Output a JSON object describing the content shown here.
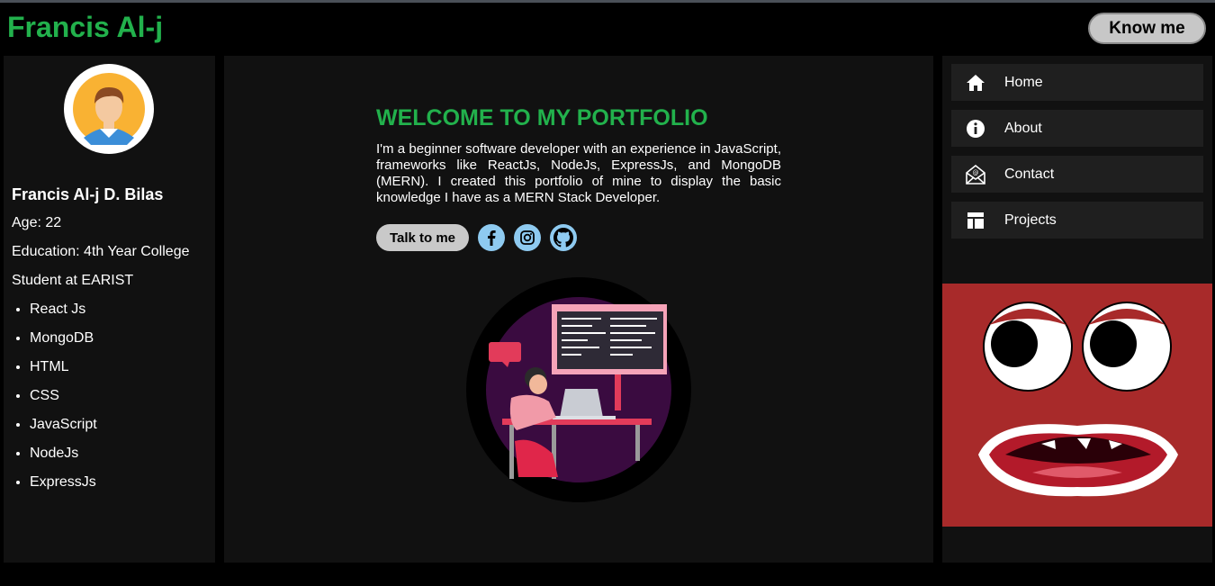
{
  "header": {
    "brand": "Francis Al-j",
    "know_me_label": "Know me"
  },
  "profile": {
    "name": "Francis Al-j D. Bilas",
    "age": "Age: 22",
    "education_line1": "Education: 4th Year College",
    "education_line2": "Student at EARIST",
    "skills": [
      "React Js",
      "MongoDB",
      "HTML",
      "CSS",
      "JavaScript",
      "NodeJs",
      "ExpressJs"
    ]
  },
  "main": {
    "heading": "WELCOME TO MY PORTFOLIO",
    "intro": "I'm a beginner software developer with an experience in JavaScript, frameworks like ReactJs, NodeJs, ExpressJs, and MongoDB (MERN). I created this portfolio of mine to display the basic knowledge I have as a MERN Stack Developer.",
    "talk_label": "Talk to me",
    "socials": [
      "facebook-icon",
      "instagram-icon",
      "github-icon"
    ]
  },
  "nav": {
    "items": [
      {
        "label": "Home",
        "icon": "home-icon"
      },
      {
        "label": "About",
        "icon": "info-icon"
      },
      {
        "label": "Contact",
        "icon": "contact-mail-icon"
      },
      {
        "label": "Projects",
        "icon": "layout-icon"
      }
    ]
  },
  "colors": {
    "accent": "#22b14c",
    "background": "#000000",
    "panel": "#111111",
    "nav_item": "#1f1f1f",
    "social_button": "#8ecaf0",
    "button_grey": "#c9c9c9",
    "monster_bg": "#a82a2a"
  }
}
